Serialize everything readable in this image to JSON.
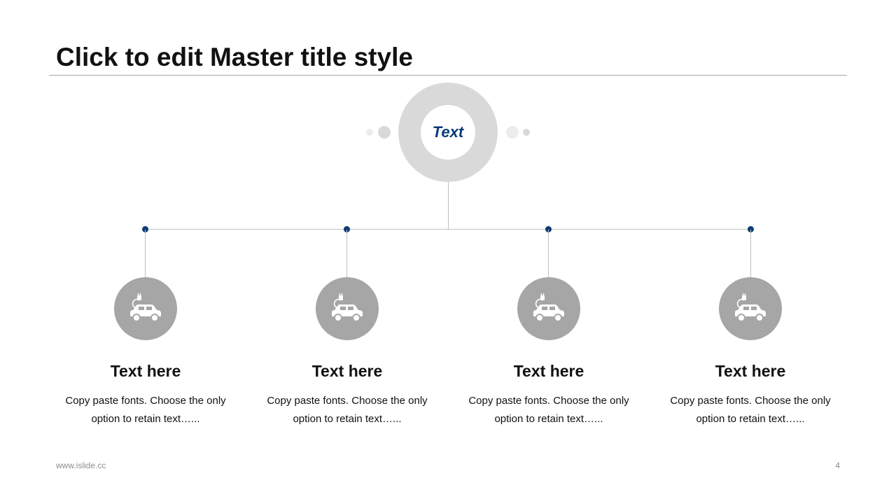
{
  "slide": {
    "title": "Click to edit Master title style",
    "center_label": "Text",
    "footer_url": "www.islide.cc",
    "page_number": "4"
  },
  "colors": {
    "accent": "#0b3b78",
    "ring": "#d9d9d9",
    "icon_circle": "#a6a6a6",
    "line": "#bfbfbf"
  },
  "items": [
    {
      "icon": "electric-car-icon",
      "title": "Text here",
      "body": "Copy paste fonts. Choose the only option to retain text…..."
    },
    {
      "icon": "electric-car-icon",
      "title": "Text here",
      "body": "Copy paste fonts. Choose the only option to retain text…..."
    },
    {
      "icon": "electric-car-icon",
      "title": "Text here",
      "body": "Copy paste fonts. Choose the only option to retain text…..."
    },
    {
      "icon": "electric-car-icon",
      "title": "Text here",
      "body": "Copy paste fonts. Choose the only option to retain text…..."
    }
  ]
}
